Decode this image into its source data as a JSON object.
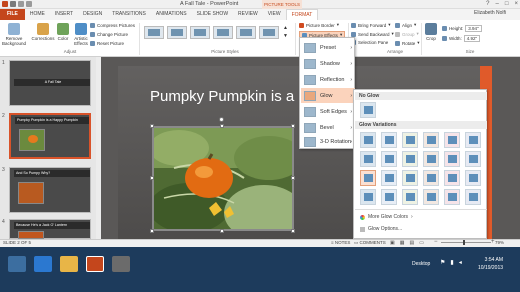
{
  "window": {
    "title": "A Fall Tale - PowerPoint",
    "contextual_tab_group": "PICTURE TOOLS",
    "controls": [
      "?",
      "–",
      "□",
      "×"
    ]
  },
  "tabs": [
    "FILE",
    "HOME",
    "INSERT",
    "DESIGN",
    "TRANSITIONS",
    "ANIMATIONS",
    "SLIDE SHOW",
    "REVIEW",
    "VIEW",
    "FORMAT"
  ],
  "active_tab": "FORMAT",
  "user": "Elizabeth Nolfi",
  "ribbon": {
    "remove_background": "Remove Background",
    "corrections": "Corrections",
    "color": "Color",
    "artistic_effects": "Artistic Effects",
    "compress_pictures": "Compress Pictures",
    "change_picture": "Change Picture",
    "reset_picture": "Reset Picture",
    "group_adjust": "Adjust",
    "group_picture_styles": "Picture Styles",
    "picture_border": "Picture Border",
    "picture_effects": "Picture Effects",
    "picture_layout": "Picture Layout",
    "bring_forward": "Bring Forward",
    "send_backward": "Send Backward",
    "selection_pane": "Selection Pane",
    "align": "Align",
    "group": "Group",
    "rotate": "Rotate",
    "group_arrange": "Arrange",
    "crop": "Crop",
    "height_label": "Height:",
    "height_value": "3.94\"",
    "width_label": "Width:",
    "width_value": "4.92\"",
    "group_size": "Size"
  },
  "thumbnails": [
    {
      "num": "1",
      "title": "A Fall Tale"
    },
    {
      "num": "2",
      "title": "Pumpky Pumpkin is a Happy Pumpkin"
    },
    {
      "num": "3",
      "title": "And So Pumpy Why?"
    },
    {
      "num": "4",
      "title": "Because He's a Jack O' Lantern"
    }
  ],
  "slide": {
    "title": "Pumpky Pumpkin is a Ha"
  },
  "picture_effects_menu": [
    {
      "label": "Preset",
      "has_sub": true
    },
    {
      "label": "Shadow",
      "has_sub": true
    },
    {
      "label": "Reflection",
      "has_sub": true
    },
    {
      "label": "Glow",
      "has_sub": true,
      "highlighted": true
    },
    {
      "label": "Soft Edges",
      "has_sub": true
    },
    {
      "label": "Bevel",
      "has_sub": true
    },
    {
      "label": "3-D Rotation",
      "has_sub": true
    }
  ],
  "glow_panel": {
    "no_glow_header": "No Glow",
    "variations_header": "Glow Variations",
    "more_colors": "More Glow Colors",
    "options": "Glow Options...",
    "swatch_rows": 4,
    "swatch_cols": 6
  },
  "status": {
    "slide_count": "SLIDE 2 OF 5",
    "notes": "NOTES",
    "comments": "COMMENTS",
    "zoom": "79%"
  },
  "taskbar": {
    "desktop": "Desktop",
    "time": "3:54 AM",
    "date": "10/19/2013"
  },
  "colors": {
    "accent": "#c4461c",
    "highlight": "#fbd3bc",
    "taskbar": "#1d3b5c",
    "slide_bg": "#5a5857"
  }
}
